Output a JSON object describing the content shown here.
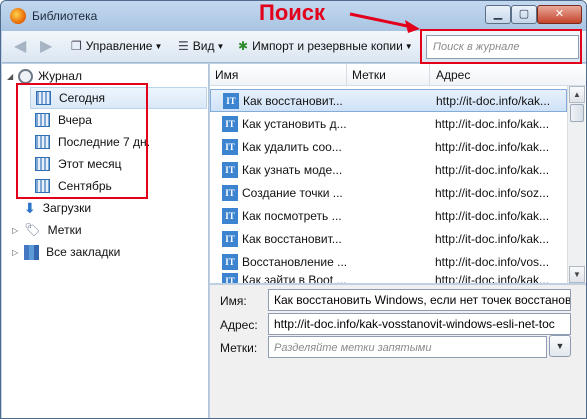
{
  "window": {
    "title": "Библиотека"
  },
  "annotation": {
    "label": "Поиск"
  },
  "toolbar": {
    "manage_label": "Управление",
    "view_label": "Вид",
    "import_label": "Импорт и резервные копии",
    "search_placeholder": "Поиск в журнале"
  },
  "tree": {
    "history_label": "Журнал",
    "history_items": [
      "Сегодня",
      "Вчера",
      "Последние 7 дн.",
      "Этот месяц",
      "Сентябрь"
    ],
    "downloads_label": "Загрузки",
    "tags_label": "Метки",
    "all_bookmarks_label": "Все закладки"
  },
  "list": {
    "columns": {
      "name": "Имя",
      "tags": "Метки",
      "address": "Адрес"
    },
    "rows": [
      {
        "name": "Как восстановит...",
        "address": "http://it-doc.info/kak..."
      },
      {
        "name": "Как установить д...",
        "address": "http://it-doc.info/kak..."
      },
      {
        "name": "Как удалить соо...",
        "address": "http://it-doc.info/kak..."
      },
      {
        "name": "Как узнать моде...",
        "address": "http://it-doc.info/kak..."
      },
      {
        "name": "Создание точки ...",
        "address": "http://it-doc.info/soz..."
      },
      {
        "name": "Как посмотреть ...",
        "address": "http://it-doc.info/kak..."
      },
      {
        "name": "Как восстановит...",
        "address": "http://it-doc.info/kak..."
      },
      {
        "name": "Восстановление ...",
        "address": "http://it-doc.info/vos..."
      },
      {
        "name": "Как зайти в Boot ...",
        "address": "http://it-doc.info/kak..."
      }
    ],
    "row_icon_text": "IT"
  },
  "details": {
    "name_label": "Имя:",
    "name_value": "Как восстановить Windows, если нет точек восстанов.",
    "address_label": "Адрес:",
    "address_value": "http://it-doc.info/kak-vosstanovit-windows-esli-net-toc",
    "tags_label": "Метки:",
    "tags_placeholder": "Разделяйте метки запятыми"
  }
}
